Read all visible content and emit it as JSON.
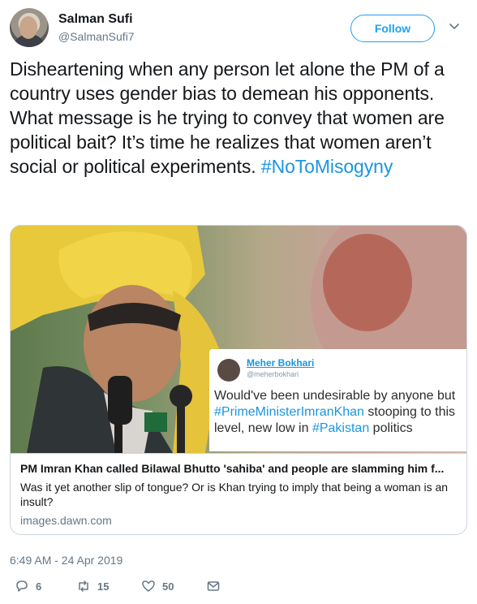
{
  "author": {
    "name": "Salman Sufi",
    "handle": "@SalmanSufi7"
  },
  "follow_label": "Follow",
  "tweet": {
    "text": "Disheartening when any person let alone the PM of a country uses gender bias to demean his opponents. What message is he trying to convey that women are political bait? It’s time he realizes that women aren’t social or political experiments. ",
    "hashtag": "#NoToMisogyny"
  },
  "card": {
    "quote": {
      "name": "Meher Bokhari",
      "handle": "@meherbokhari",
      "text_1": "Would've been undesirable by anyone but ",
      "hashtag_1": "#PrimeMinisterImranKhan",
      "text_2": " stooping to this level, new low in ",
      "hashtag_2": "#Pakistan",
      "text_3": " politics"
    },
    "title": "PM Imran Khan called Bilawal Bhutto 'sahiba' and people are slamming him f...",
    "description": "Was it yet another slip of tongue? Or is Khan trying to imply that being a woman is an insult?",
    "domain": "images.dawn.com"
  },
  "timestamp": "6:49 AM - 24 Apr 2019",
  "actions": {
    "replies": "6",
    "retweets": "15",
    "likes": "50"
  },
  "colors": {
    "accent": "#1da1f2",
    "hashtag": "#1b95e0",
    "muted": "#657786"
  },
  "icons": [
    "chevron-down-icon",
    "reply-icon",
    "retweet-icon",
    "like-icon",
    "message-icon"
  ]
}
